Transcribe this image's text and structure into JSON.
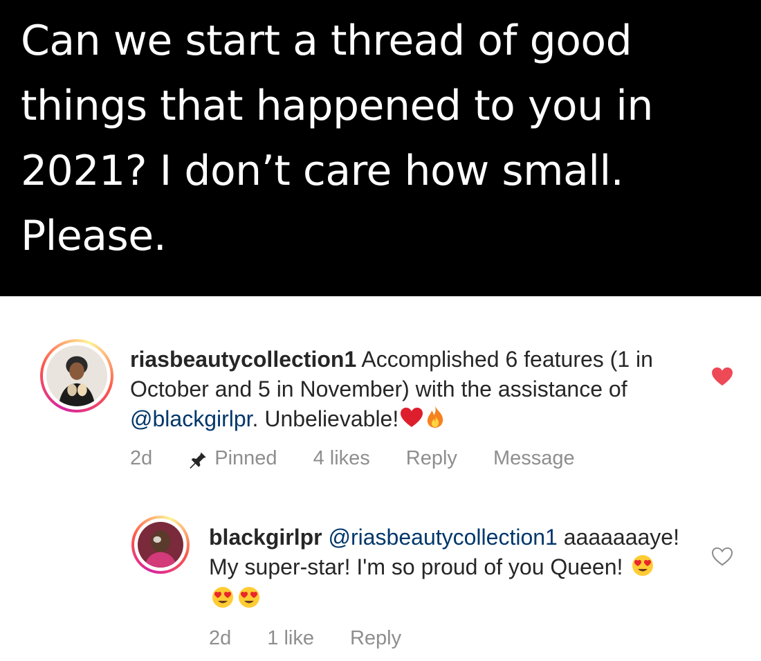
{
  "tweet": {
    "text": "Can we start a thread of good things that happened to you in 2021? I don’t care how small. Please."
  },
  "comments": [
    {
      "username": "riasbeautycollection1",
      "text_before_mention": " Accomplished 6 features (1 in October and 5 in November) with the assistance of ",
      "mention": "@blackgirlpr",
      "text_after_mention": ".  Unbelievable!",
      "emojis": [
        "red-heart-emoji",
        "fire-emoji"
      ],
      "time": "2d",
      "pinned_label": "Pinned",
      "likes": "4 likes",
      "reply_label": "Reply",
      "message_label": "Message",
      "liked": true
    },
    {
      "username": "blackgirlpr",
      "mention": "@riasbeautycollection1",
      "text": "aaaaaaaye! My super-star! I'm so proud of you Queen! ",
      "emojis": [
        "heart-eyes-emoji",
        "heart-eyes-emoji",
        "heart-eyes-emoji"
      ],
      "time": "2d",
      "likes": "1 like",
      "reply_label": "Reply",
      "liked": false
    }
  ],
  "colors": {
    "liked_heart": "#ed4956",
    "mention": "#00376b",
    "meta": "#8e8e8e"
  }
}
